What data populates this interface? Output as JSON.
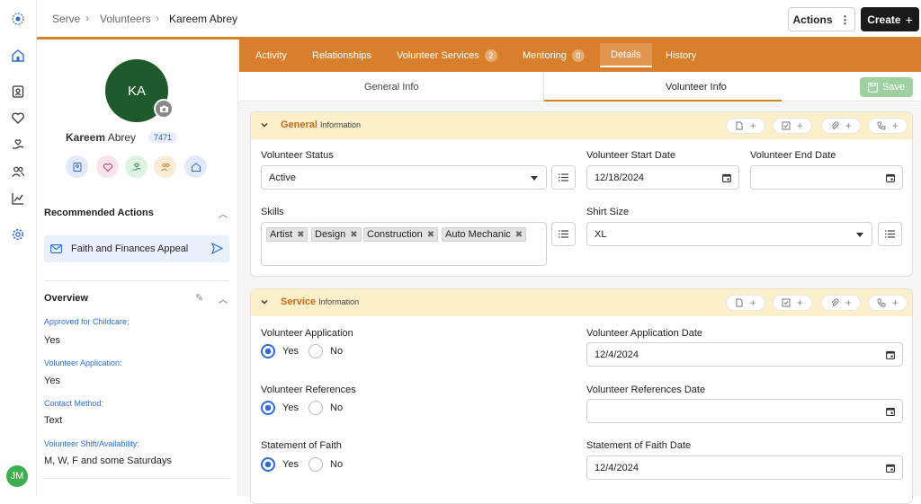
{
  "user_initials": "JM",
  "breadcrumb": {
    "root": "Serve",
    "section": "Volunteers",
    "current": "Kareem Abrey"
  },
  "header": {
    "actions_label": "Actions",
    "create_label": "Create"
  },
  "profile": {
    "initials": "KA",
    "first_name": "Kareem",
    "last_name": "Abrey",
    "id": "7471",
    "recommended_title": "Recommended Actions",
    "recommended_item": "Faith and Finances Appeal",
    "overview_title": "Overview",
    "overview": [
      {
        "label": "Approved for Childcare:",
        "value": "Yes"
      },
      {
        "label": "Volunteer Application:",
        "value": "Yes"
      },
      {
        "label": "Contact Method:",
        "value": "Text"
      },
      {
        "label": "Volunteer Shift/Availability:",
        "value": "M, W, F and some Saturdays"
      }
    ]
  },
  "tabs": [
    {
      "label": "Activity"
    },
    {
      "label": "Relationships"
    },
    {
      "label": "Volunteer Services",
      "badge": "2"
    },
    {
      "label": "Mentoring",
      "badge": "0"
    },
    {
      "label": "Details"
    },
    {
      "label": "History"
    }
  ],
  "subtabs": {
    "general": "General Info",
    "volunteer": "Volunteer Info",
    "save": "Save"
  },
  "general": {
    "title": "General",
    "subtitle": "Information",
    "status_label": "Volunteer Status",
    "status_value": "Active",
    "start_label": "Volunteer Start Date",
    "start_value": "12/18/2024",
    "end_label": "Volunteer End Date",
    "end_value": "",
    "skills_label": "Skills",
    "skills": [
      "Artist",
      "Design",
      "Construction",
      "Auto Mechanic"
    ],
    "shirt_label": "Shirt Size",
    "shirt_value": "XL"
  },
  "service": {
    "title": "Service",
    "subtitle": "Information",
    "app_label": "Volunteer Application",
    "app_date_label": "Volunteer Application Date",
    "app_date_value": "12/4/2024",
    "ref_label": "Volunteer References",
    "ref_date_label": "Volunteer References Date",
    "ref_date_value": "",
    "faith_label": "Statement of Faith",
    "faith_date_label": "Statement of Faith Date",
    "faith_date_value": "12/4/2024",
    "yes": "Yes",
    "no": "No"
  }
}
